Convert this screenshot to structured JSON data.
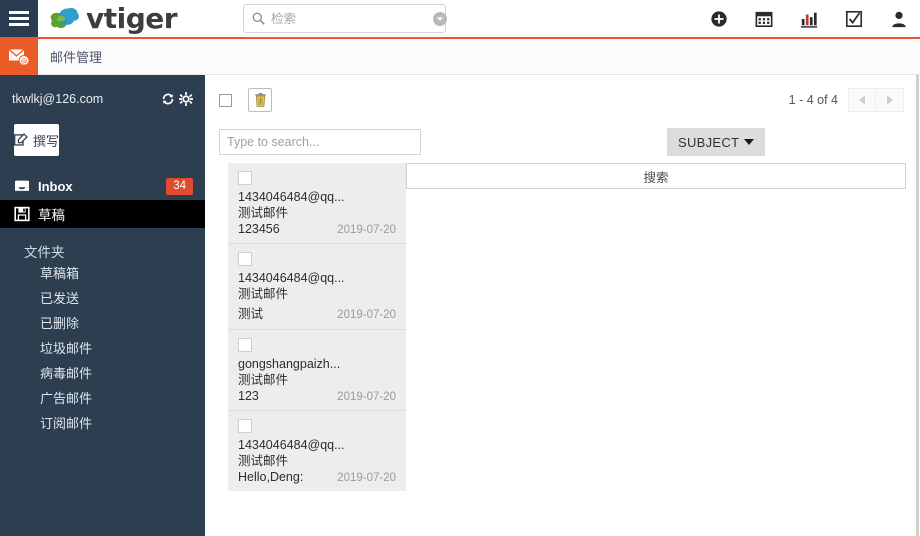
{
  "header": {
    "menu_icon": "hamburger-icon",
    "logo_text": "vtiger",
    "search": {
      "placeholder": "检索",
      "value": "",
      "icon": "search-icon",
      "caret_icon": "chevron-down-circle-icon"
    },
    "icons": [
      {
        "name": "add-circle-icon",
        "label": "新增"
      },
      {
        "name": "calendar-icon",
        "label": "日历"
      },
      {
        "name": "bar-chart-icon",
        "label": "报表"
      },
      {
        "name": "checkbox-task-icon",
        "label": "任务"
      },
      {
        "name": "user-profile-icon",
        "label": "用户"
      }
    ],
    "accent_color": "#e9582a",
    "bar_color": "#2b3b50"
  },
  "module_bar": {
    "module_icon": "mail-at-icon",
    "module_icon_color": "#ea5c28",
    "breadcrumb": "邮件管理"
  },
  "sidebar": {
    "background": "#2d3e50",
    "account_email": "tkwlkj@126.com",
    "account_icons": [
      {
        "name": "refresh-icon"
      },
      {
        "name": "gear-icon"
      }
    ],
    "compose_label": "撰写",
    "compose_icon": "compose-pencil-icon",
    "nav": [
      {
        "label": "Inbox",
        "icon": "inbox-tray-icon",
        "badge": "34",
        "active": false
      },
      {
        "label": "草稿",
        "icon": "floppy-save-icon",
        "badge": "",
        "active": true
      }
    ],
    "folders_header": "文件夹",
    "folders": [
      {
        "label": "草稿箱"
      },
      {
        "label": "已发送"
      },
      {
        "label": "已删除"
      },
      {
        "label": "垃圾邮件"
      },
      {
        "label": "病毒邮件"
      },
      {
        "label": "广告邮件"
      },
      {
        "label": "订阅邮件"
      }
    ],
    "badge_color": "#e04a2f",
    "active_color": "#000000"
  },
  "toolbar": {
    "select_all_checked": false,
    "delete_icon": "trash-icon",
    "pagination_text": "1 - 4 of 4",
    "prev_icon": "chevron-left-icon",
    "next_icon": "chevron-right-icon",
    "prev_disabled": true,
    "next_disabled": true
  },
  "filter": {
    "search_placeholder": "Type to search...",
    "search_value": "",
    "sort_label": "SUBJECT",
    "sort_caret_icon": "caret-down-icon"
  },
  "mail_list": [
    {
      "from": "1434046484@qq...",
      "subject": "测试邮件",
      "preview": "123456",
      "date": "2019-07-20",
      "checked": false
    },
    {
      "from": "1434046484@qq...",
      "subject": "测试邮件",
      "preview": "测试",
      "date": "2019-07-20",
      "checked": false
    },
    {
      "from": "gongshangpaizh...",
      "subject": "测试邮件",
      "preview": "123",
      "date": "2019-07-20",
      "checked": false
    },
    {
      "from": "1434046484@qq...",
      "subject": "测试邮件",
      "preview": "Hello,Deng:",
      "date": "2019-07-20",
      "checked": false
    }
  ],
  "reading_pane": {
    "title": "搜索"
  }
}
